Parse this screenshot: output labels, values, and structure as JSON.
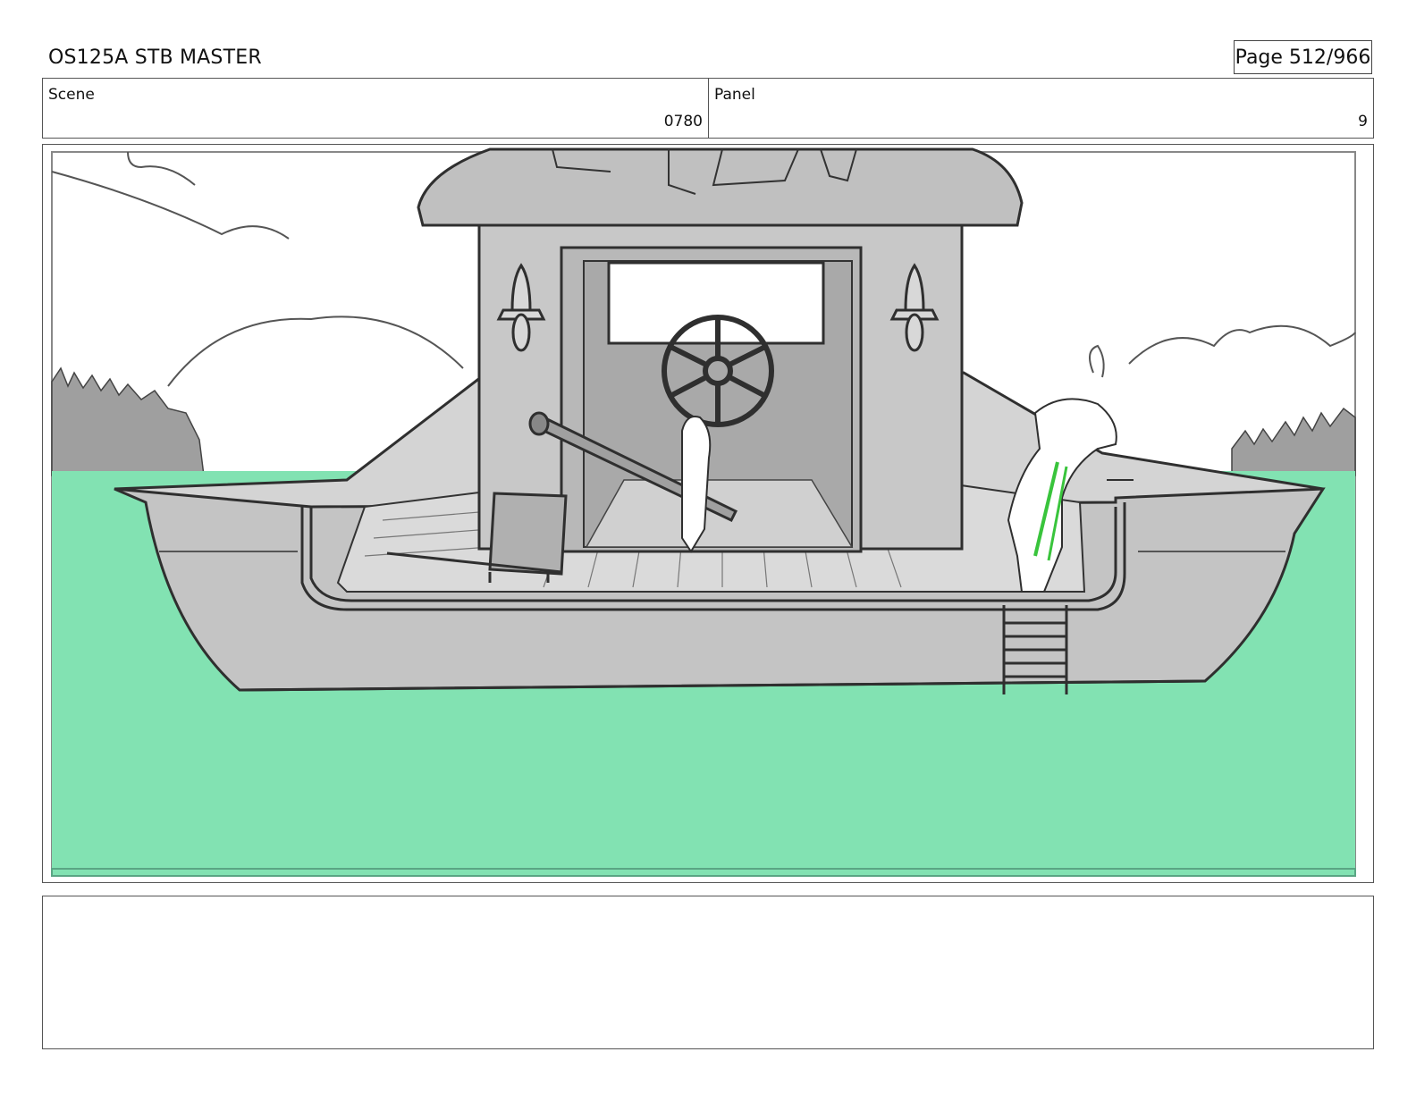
{
  "header": {
    "title": "OS125A STB MASTER",
    "page": "Page 512/966"
  },
  "info": {
    "scene_label": "Scene",
    "scene_value": "0780",
    "panel_label": "Panel",
    "panel_value": "9"
  },
  "colors": {
    "water": "#82e2b2",
    "sky": "#ffffff",
    "boat_gray": "#b9b9b9",
    "line": "#2f2f2f",
    "character_accent": "#39c43c"
  }
}
